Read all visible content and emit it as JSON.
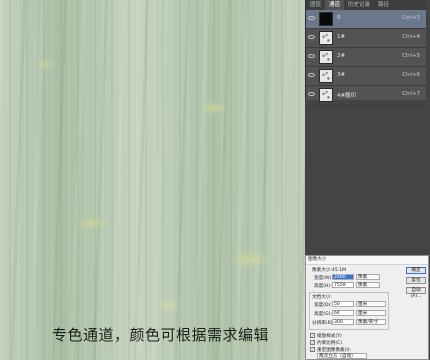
{
  "canvas": {
    "caption": "专色通道，颜色可根据需求编辑"
  },
  "channels_panel": {
    "tabs": [
      {
        "label": "图层",
        "active": false
      },
      {
        "label": "通道",
        "active": true
      },
      {
        "label": "历史记录",
        "active": false
      },
      {
        "label": "路径",
        "active": false
      }
    ],
    "rows": [
      {
        "name": "0",
        "shortcut": "Ctrl+3",
        "thumb": "black",
        "selected": true
      },
      {
        "name": "1#",
        "shortcut": "Ctrl+4",
        "thumb": "texture",
        "selected": false
      },
      {
        "name": "2#",
        "shortcut": "Ctrl+5",
        "thumb": "texture",
        "selected": false
      },
      {
        "name": "3#",
        "shortcut": "Ctrl+6",
        "thumb": "texture",
        "selected": false
      },
      {
        "name": "4#腹印",
        "shortcut": "Ctrl+7",
        "thumb": "texture",
        "selected": false
      }
    ]
  },
  "image_size_dialog": {
    "title": "图像大小",
    "pixel_size": "像素大小:45.1M",
    "pixel_width_label": "宽度(W):",
    "pixel_width": "2480",
    "pixel_width_unit": "像素",
    "pixel_height_label": "高度(H):",
    "pixel_height": "7559",
    "pixel_height_unit": "像素",
    "doc_size_label": "文档大小:",
    "doc_width_label": "宽度(D):",
    "doc_width": "50",
    "doc_width_unit": "厘米",
    "doc_height_label": "高度(G):",
    "doc_height": "64",
    "doc_height_unit": "厘米",
    "resolution_label": "分辨率(R):",
    "resolution": "300",
    "resolution_unit": "像素/英寸",
    "ok_label": "确定",
    "cancel_label": "复位",
    "auto_label": "自动(A)...",
    "scale_styles_label": "缩放样式(Y)",
    "constrain_label": "约束比例(C)",
    "resample_label": "重定图像像素(I):",
    "resample_method": "两次立方（自动）"
  }
}
